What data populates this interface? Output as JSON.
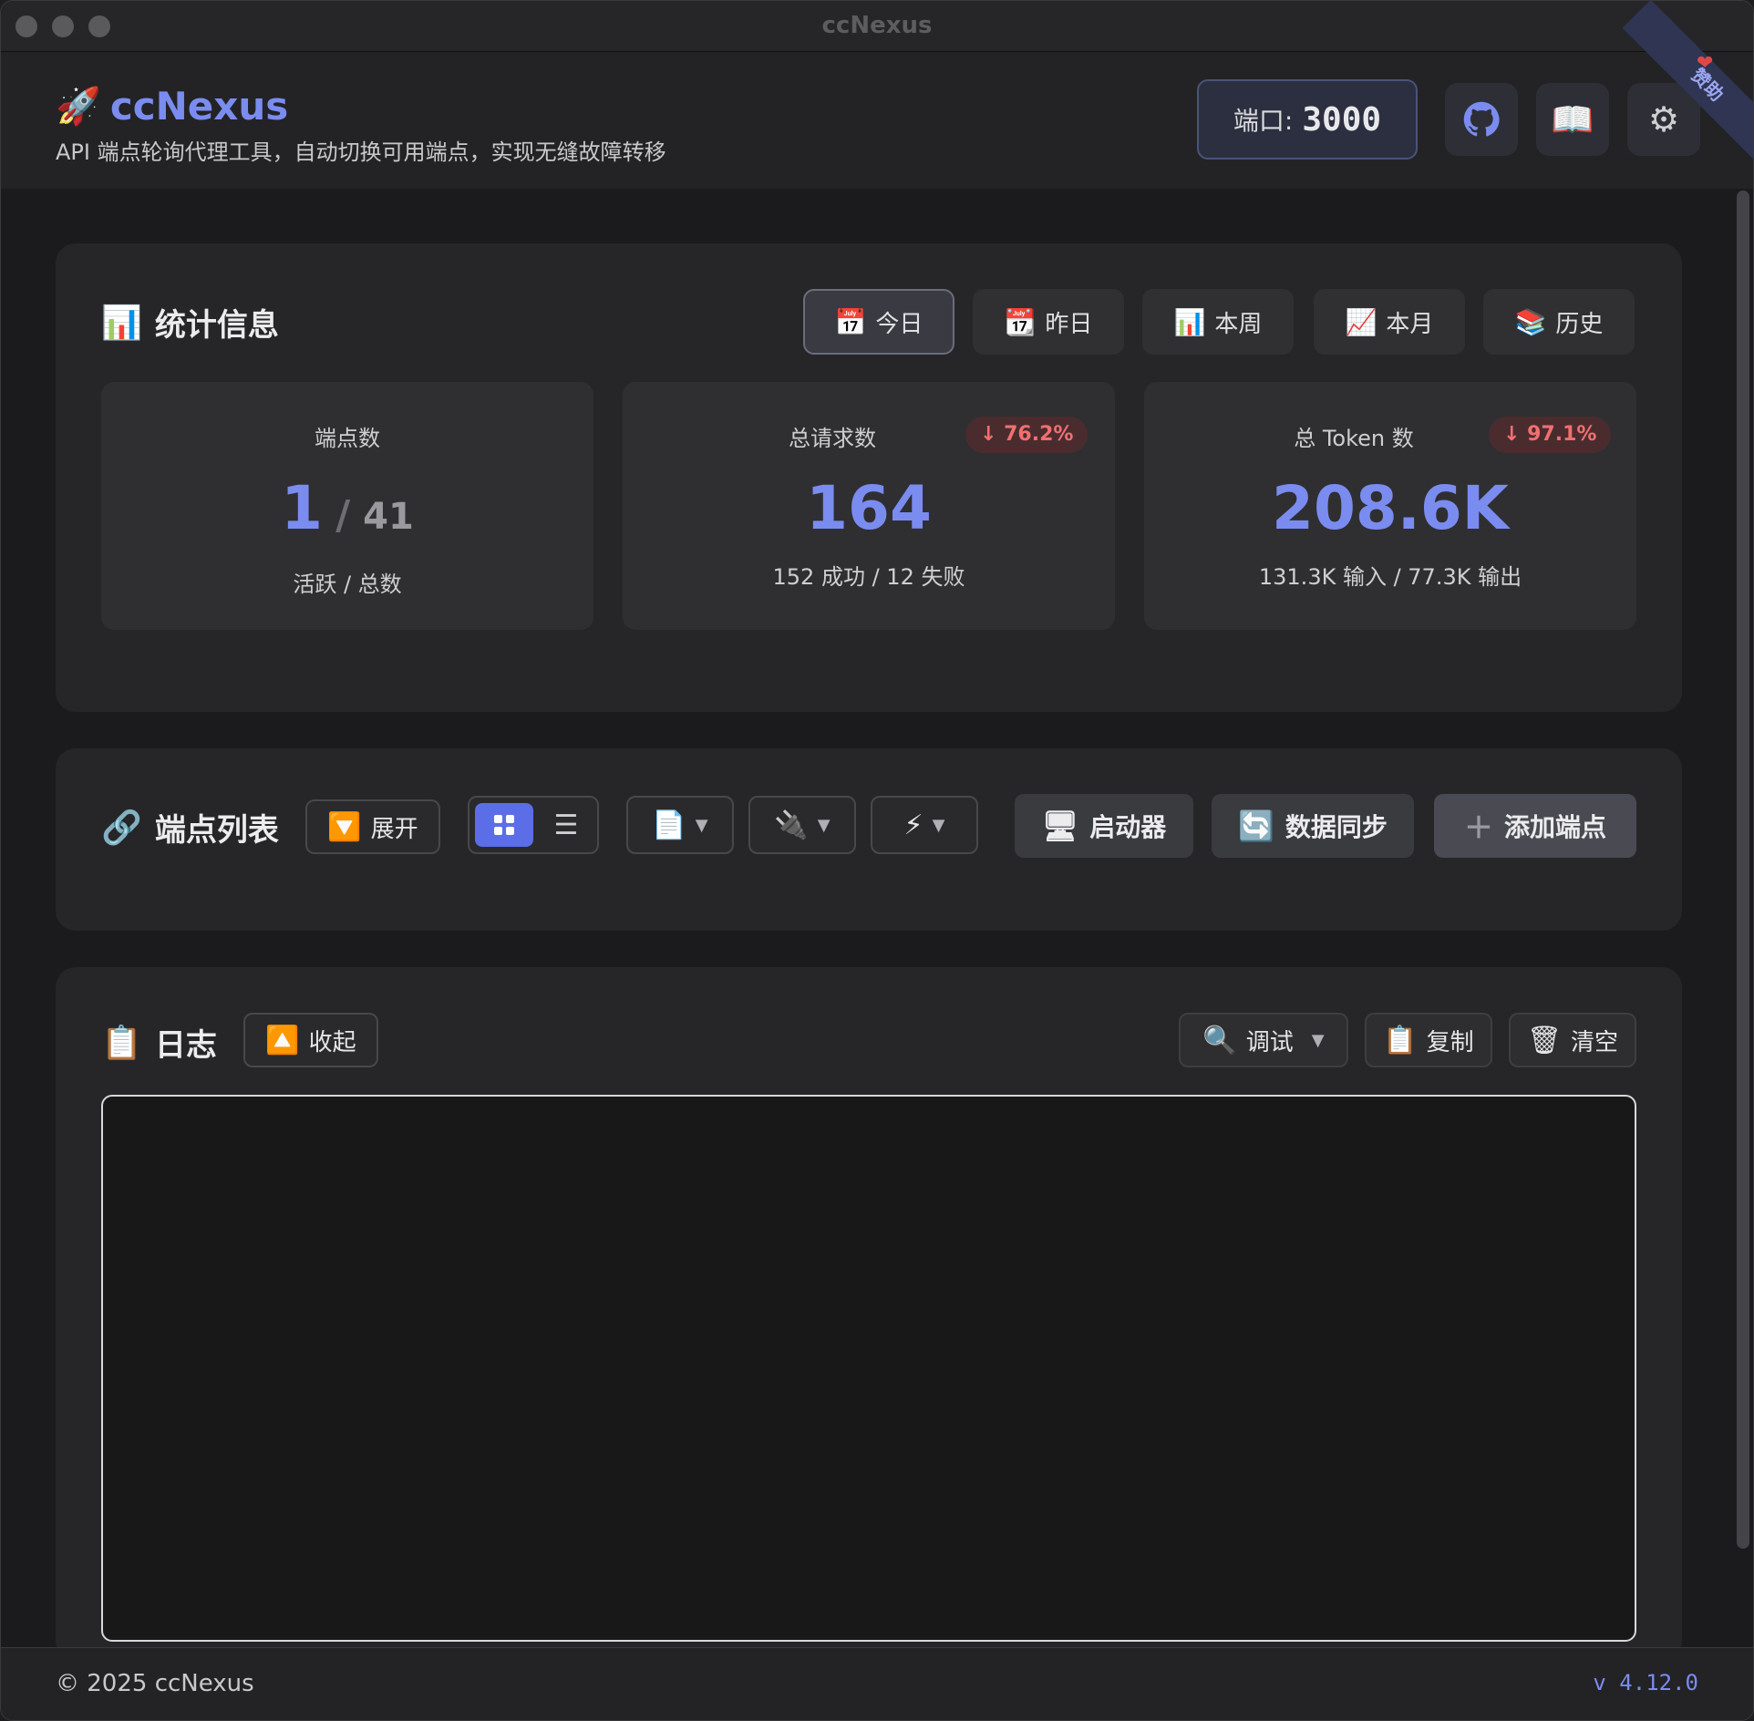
{
  "window": {
    "title": "ccNexus"
  },
  "header": {
    "app_name": "ccNexus",
    "subtitle": "API 端点轮询代理工具，自动切换可用端点，实现无缝故障转移",
    "port_label": "端口:",
    "port_value": "3000",
    "sponsor_label": "赞助"
  },
  "stats": {
    "title": "统计信息",
    "ranges": [
      {
        "label": "今日",
        "icon": "calendar-icon"
      },
      {
        "label": "昨日",
        "icon": "calendar-icon"
      },
      {
        "label": "本周",
        "icon": "bar-chart-icon"
      },
      {
        "label": "本月",
        "icon": "trend-icon"
      },
      {
        "label": "历史",
        "icon": "books-icon"
      }
    ],
    "active_range": "今日",
    "endpoints": {
      "label": "端点数",
      "active": "1",
      "slash": "/",
      "total": "41",
      "sub": "活跃 / 总数"
    },
    "requests": {
      "label": "总请求数",
      "change": "↓ 76.2%",
      "value": "164",
      "sub": "152 成功 / 12 失败"
    },
    "tokens": {
      "label": "总 Token 数",
      "change": "↓ 97.1%",
      "value": "208.6K",
      "sub": "131.3K 输入 / 77.3K 输出"
    },
    "badge_color": "#f07070"
  },
  "endpoints": {
    "title": "端点列表",
    "expand_label": "展开",
    "launcher_label": "启动器",
    "sync_label": "数据同步",
    "add_label": "添加端点",
    "caret": "▼"
  },
  "logs": {
    "title": "日志",
    "collapse_label": "收起",
    "level_label": "调试",
    "copy_label": "复制",
    "clear_label": "清空"
  },
  "footer": {
    "copyright": "© 2025 ccNexus",
    "version": "v 4.12.0"
  },
  "colors": {
    "accent": "#7b8cf0",
    "danger": "#f07070",
    "background": "#1b1b1d"
  }
}
